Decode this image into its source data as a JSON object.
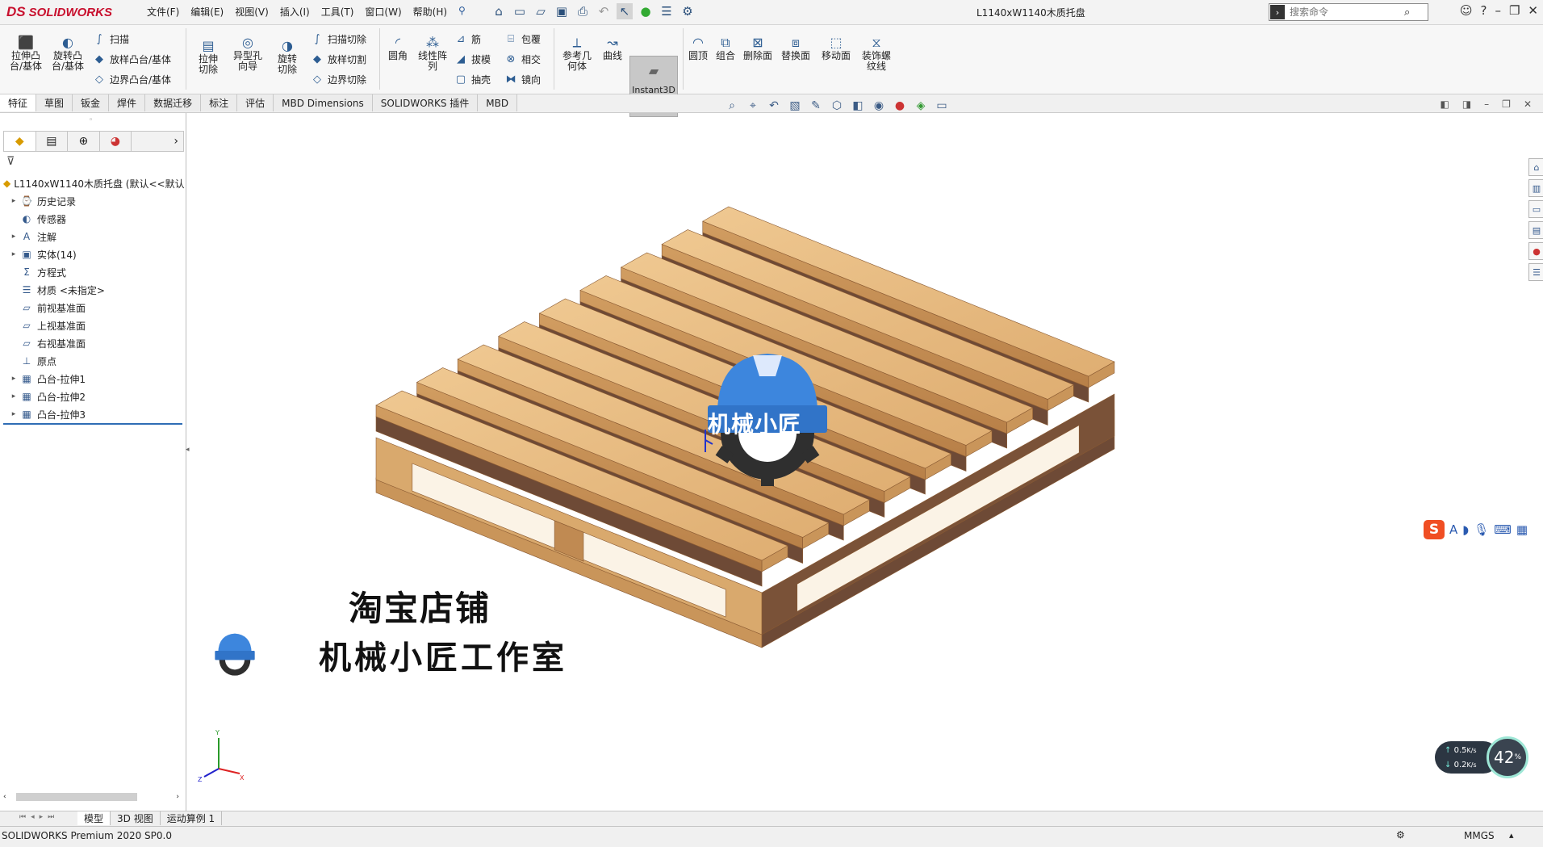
{
  "app": {
    "brand": "SOLIDWORKS",
    "brand_prefix": "DS"
  },
  "menu": [
    "文件(F)",
    "编辑(E)",
    "视图(V)",
    "插入(I)",
    "工具(T)",
    "窗口(W)",
    "帮助(H)"
  ],
  "document_title": "L1140xW1140木质托盘",
  "search": {
    "placeholder": "搜索命令"
  },
  "ribbon": {
    "extrude_boss": "拉伸凸台/基体",
    "revolve_boss": "旋转凸台/基体",
    "sweep": "扫描",
    "loft_boss": "放样凸台/基体",
    "boundary_boss": "边界凸台/基体",
    "extrude_cut": "拉伸切除",
    "hole_wizard": "异型孔向导",
    "revolve_cut": "旋转切除",
    "sweep_cut": "扫描切除",
    "loft_cut": "放样切割",
    "boundary_cut": "边界切除",
    "fillet": "圆角",
    "linear_pattern": "线性阵列",
    "rib": "筋",
    "draft": "拔模",
    "shell": "抽壳",
    "wrap": "包覆",
    "intersect": "相交",
    "mirror": "镜向",
    "ref_geometry": "参考几何体",
    "curves": "曲线",
    "instant3d": "Instant3D",
    "dome": "圆顶",
    "combine": "组合",
    "delete_face": "删除面",
    "replace_face": "替换面",
    "move_face": "移动面",
    "cosmetic_thread": "装饰螺纹线"
  },
  "tabs": [
    "特征",
    "草图",
    "钣金",
    "焊件",
    "数据迁移",
    "标注",
    "评估",
    "MBD Dimensions",
    "SOLIDWORKS 插件",
    "MBD"
  ],
  "feature_tree": {
    "root": "L1140xW1140木质托盘 (默认<<默认",
    "items": [
      {
        "label": "历史记录",
        "icon": "history-icon",
        "expandable": true
      },
      {
        "label": "传感器",
        "icon": "sensor-icon",
        "expandable": false
      },
      {
        "label": "注解",
        "icon": "annotation-icon",
        "expandable": true
      },
      {
        "label": "实体(14)",
        "icon": "solid-bodies-icon",
        "expandable": true
      },
      {
        "label": "方程式",
        "icon": "equation-icon",
        "expandable": false
      },
      {
        "label": "材质 <未指定>",
        "icon": "material-icon",
        "expandable": false
      },
      {
        "label": "前视基准面",
        "icon": "plane-icon",
        "expandable": false
      },
      {
        "label": "上视基准面",
        "icon": "plane-icon",
        "expandable": false
      },
      {
        "label": "右视基准面",
        "icon": "plane-icon",
        "expandable": false
      },
      {
        "label": "原点",
        "icon": "origin-icon",
        "expandable": false
      },
      {
        "label": "凸台-拉伸1",
        "icon": "extrude-feature-icon",
        "expandable": true
      },
      {
        "label": "凸台-拉伸2",
        "icon": "extrude-feature-icon",
        "expandable": true
      },
      {
        "label": "凸台-拉伸3",
        "icon": "extrude-feature-icon",
        "expandable": true
      }
    ]
  },
  "bottom_tabs": [
    "模型",
    "3D 视图",
    "运动算例 1"
  ],
  "status": {
    "version": "SOLIDWORKS Premium 2020 SP0.0",
    "units": "MMGS"
  },
  "watermark": {
    "shop_line": "淘宝店铺",
    "studio_line": "机械小匠工作室",
    "badge_text": "机械小匠"
  },
  "network_widget": {
    "up": "0.5",
    "up_unit": "K/s",
    "down": "0.2",
    "down_unit": "K/s",
    "percent": "42",
    "percent_unit": "%"
  },
  "ime": {
    "letter": "S",
    "mode": "A"
  },
  "colors": {
    "accent": "#2f6db5",
    "wood_top": "#e7bb82",
    "wood_side": "#c9955a",
    "wood_dark": "#6e4a36",
    "badge_blue": "#3b7fd6",
    "brand_red": "#c8102e"
  }
}
